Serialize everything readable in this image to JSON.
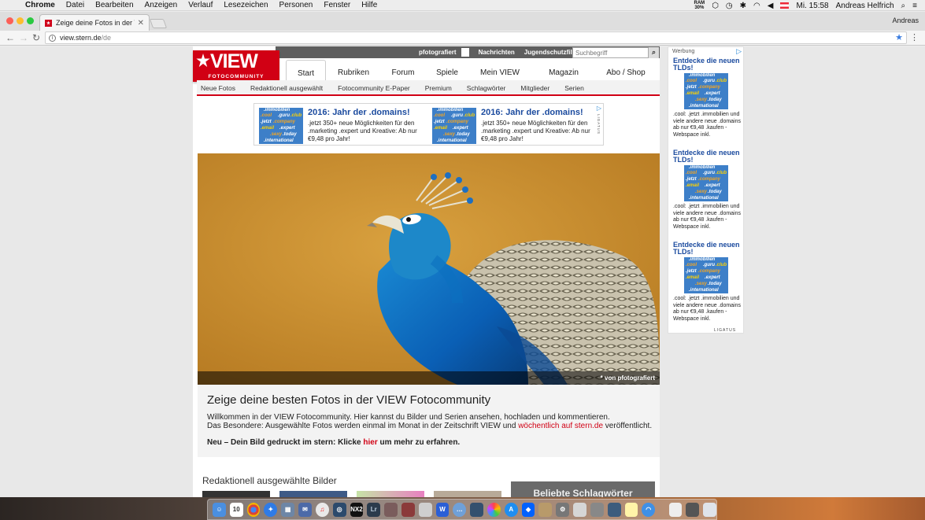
{
  "menubar": {
    "app": "Chrome",
    "items": [
      "Datei",
      "Bearbeiten",
      "Anzeigen",
      "Verlauf",
      "Lesezeichen",
      "Personen",
      "Fenster",
      "Hilfe"
    ],
    "ram_label": "RAM",
    "ram_value": "30%",
    "clock": "Mi. 15:58",
    "user": "Andreas Helfrich"
  },
  "browser": {
    "tab_title": "Zeige deine Fotos in der VIEW",
    "profile": "Andreas",
    "url_host": "view.stern.de",
    "url_path": "/de"
  },
  "site": {
    "topbar": {
      "pf_label": "pfotografiert",
      "news": "Nachrichten",
      "filter": "Jugendschutzfilter",
      "search_placeholder": "Suchbegriff"
    },
    "logo": {
      "word": "VIEW",
      "sub": "FOTOCOMMUNITY"
    },
    "mainnav": [
      "Start",
      "Rubriken",
      "Forum",
      "Spiele",
      "Mein VIEW",
      "Magazin",
      "Abo / Shop"
    ],
    "subnav": [
      "Neue Fotos",
      "Redaktionell ausgewählt",
      "Fotocommunity E-Paper",
      "Premium",
      "Schlagwörter",
      "Mitglieder",
      "Serien"
    ],
    "ad_top": {
      "title": "2016: Jahr der .domains!",
      "text": ".jetzt 350+ neue Möglichkeiten für den .marketing .expert und Kreative: Ab nur €9,48 pro Jahr!",
      "tld_words": [
        ".immobilien",
        ".cool",
        ".guru",
        ".club",
        ".jetzt",
        ".company",
        ".email",
        ".expert",
        ".sexy",
        ".today",
        ".international"
      ],
      "ligatus": "LIGATUS"
    },
    "hero": {
      "credit": "* von pfotografiert"
    },
    "intro": {
      "heading": "Zeige deine besten Fotos in der VIEW Fotocommunity",
      "line1": "Willkommen in der VIEW Fotocommunity. Hier kannst du Bilder und Serien ansehen, hochladen und kommentieren.",
      "line2_pre": "Das Besondere: Ausgewählte Fotos werden einmal im Monat in der Zeitschrift VIEW und ",
      "line2_link": "wöchentlich auf stern.de",
      "line2_post": " veröffentlicht.",
      "line3_pre": "Neu – Dein Bild gedruckt im stern: Klicke ",
      "line3_link": "hier",
      "line3_post": " um mehr zu erfahren."
    },
    "section_title": "Redaktionell ausgewählte Bilder",
    "tags_box": "Beliebte Schlagwörter"
  },
  "rail": {
    "label": "Werbung",
    "units": [
      {
        "title": "Entdecke die neuen TLDs!",
        "text": ".cool: .jetzt .immobilien und viele andere neue .domains ab nur €9,48 .kaufen - Webspace inkl."
      },
      {
        "title": "Entdecke die neuen TLDs!",
        "text": ".cool: .jetzt .immobilien und viele andere neue .domains ab nur €9,48 .kaufen - Webspace inkl."
      },
      {
        "title": "Entdecke die neuen TLDs!",
        "text": ".cool: .jetzt .immobilien und viele andere neue .domains ab nur €9,48 .kaufen - Webspace inkl."
      }
    ],
    "ligatus": "LIGATUS"
  },
  "dock": {
    "calendar_day": "10",
    "lr_label": "Lr",
    "nx_label": "NX2"
  },
  "colors": {
    "brand_red": "#d10014",
    "ad_blue": "#1a4a9e",
    "hero_bg": "#cf932f"
  }
}
